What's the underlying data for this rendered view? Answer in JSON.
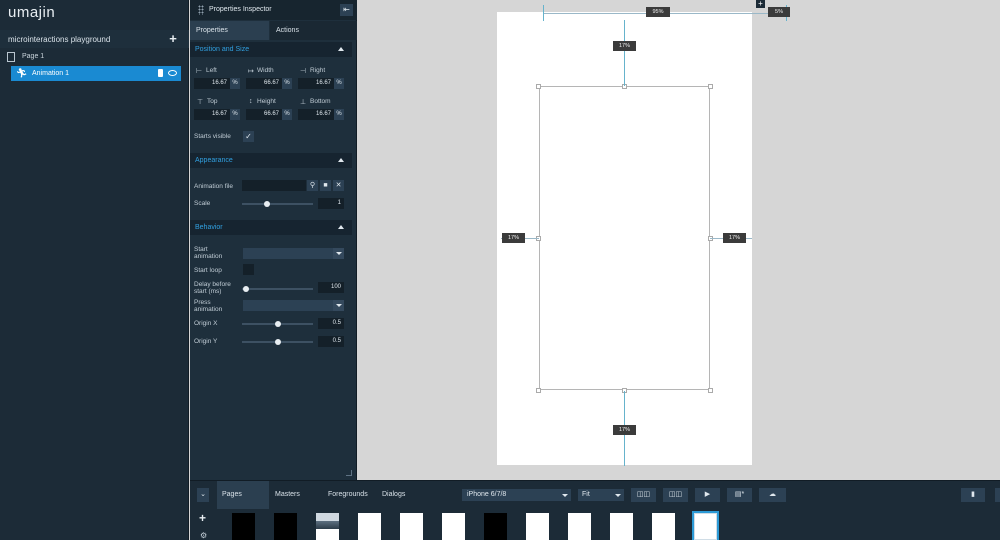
{
  "app": {
    "logo": "umajin",
    "project_name": "microinteractions playground",
    "tree": {
      "page_label": "Page 1",
      "animation_label": "Animation 1"
    }
  },
  "inspector": {
    "title": "Properties Inspector",
    "tabs": [
      "Properties",
      "Actions"
    ],
    "position_size": {
      "header": "Position and Size",
      "left_label": "Left",
      "left_value": "16.67",
      "width_label": "Width",
      "width_value": "66.67",
      "right_label": "Right",
      "right_value": "16.67",
      "top_label": "Top",
      "top_value": "16.67",
      "height_label": "Height",
      "height_value": "66.67",
      "bottom_label": "Bottom",
      "bottom_value": "16.67",
      "unit": "%",
      "starts_visible_label": "Starts visible",
      "starts_visible_checked": true
    },
    "appearance": {
      "header": "Appearance",
      "animation_file_label": "Animation file",
      "animation_file_value": "",
      "scale_label": "Scale",
      "scale_value": "1"
    },
    "behavior": {
      "header": "Behavior",
      "start_animation_label_1": "Start",
      "start_animation_label_2": "animation",
      "start_loop_label": "Start loop",
      "delay_label_1": "Delay before",
      "delay_label_2": "start (ms)",
      "delay_value": "100",
      "press_animation_label_1": "Press",
      "press_animation_label_2": "animation",
      "origin_x_label": "Origin X",
      "origin_x_value": "0.5",
      "origin_y_label": "Origin Y",
      "origin_y_value": "0.5"
    }
  },
  "canvas": {
    "top_guide_label": "95%",
    "top_right_label": "5%",
    "top_margin_label": "17%",
    "left_margin_label": "17%",
    "right_margin_label": "17%",
    "bottom_margin_label": "17%"
  },
  "bottom_bar": {
    "tabs": [
      "Pages",
      "Masters",
      "Foregrounds",
      "Dialogs"
    ],
    "device": "iPhone 6/7/8",
    "zoom": "Fit"
  },
  "colors": {
    "accent": "#1a8ad2",
    "section_header_text": "#31a0e0",
    "panel_bg": "#1c2b37",
    "canvas_bg": "#d6d6d6"
  }
}
